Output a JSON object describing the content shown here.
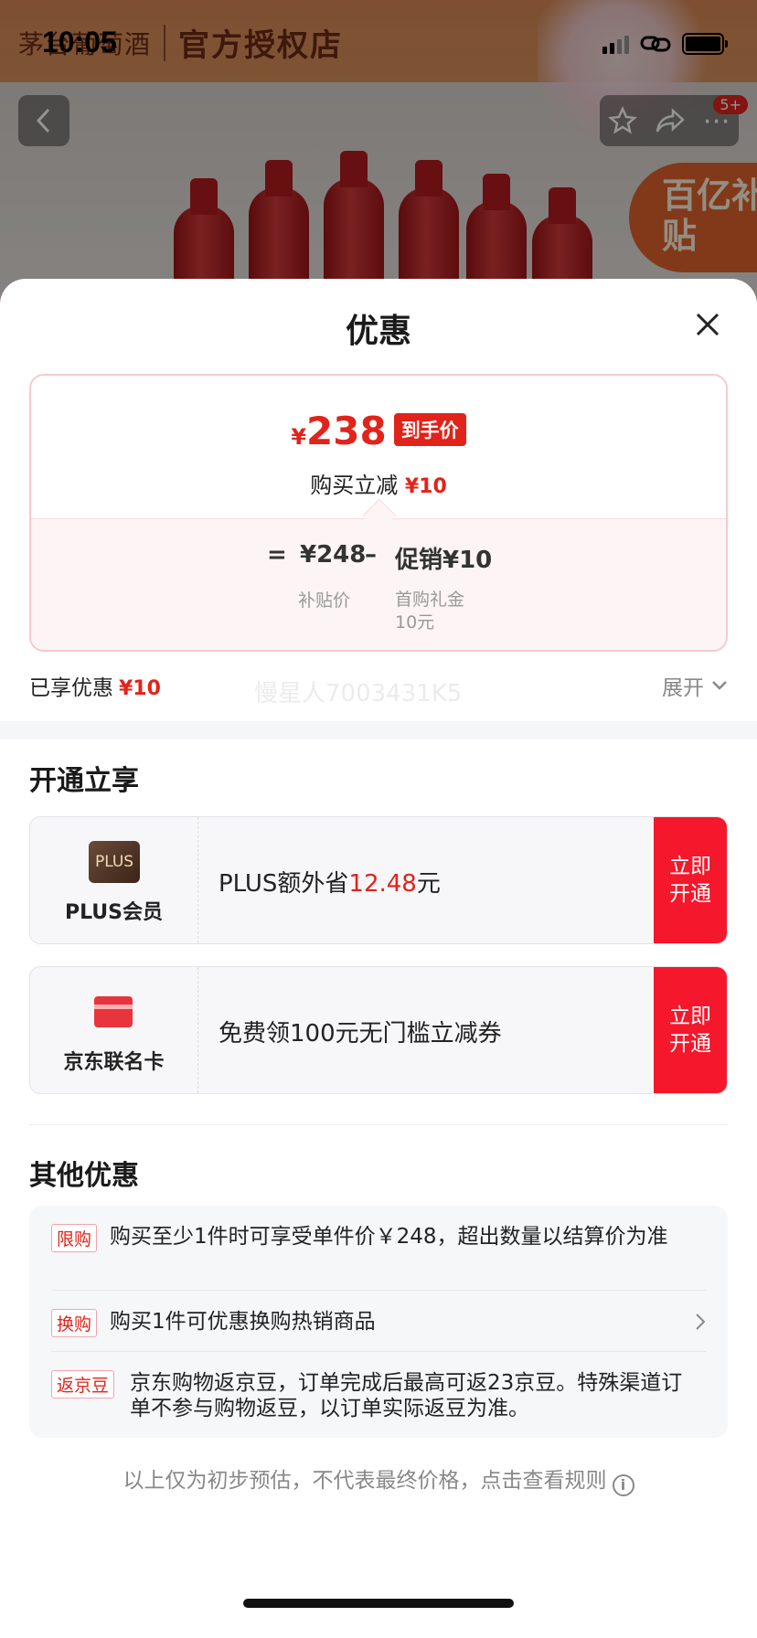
{
  "status_bar": {
    "time": "10:05"
  },
  "background": {
    "shop_logo": "茅台葡萄酒",
    "shop_name": "官方授权店",
    "badge_text": "百亿补贴",
    "notification_count": "5+"
  },
  "sheet": {
    "title": "优惠"
  },
  "price_box": {
    "currency": "¥",
    "final_price": "238",
    "final_tag": "到手价",
    "discount_label": "购买立减",
    "discount_amount": "¥10",
    "formula_equal": "=",
    "base_price": "¥248",
    "formula_minus": "–",
    "promo_label": "促销¥10",
    "base_price_label": "补贴价",
    "promo_detail_1": "首购礼金",
    "promo_detail_2": "10元"
  },
  "saved": {
    "label": "已享优惠",
    "amount": "¥10",
    "expand_label": "展开"
  },
  "open_section": {
    "title": "开通立享",
    "watermark": "慢星人7003431K5"
  },
  "plus_card": {
    "icon_text": "PLUS",
    "name": "PLUS会员",
    "text_prefix": "PLUS额外省",
    "amount": "12.48",
    "text_suffix": "元",
    "button": "立即开通"
  },
  "jd_card": {
    "name": "京东联名卡",
    "text": "免费领100元无门槛立减券",
    "button": "立即开通"
  },
  "others": {
    "title": "其他优惠",
    "items": [
      {
        "tag": "限购",
        "text": "购买至少1件时可享受单件价￥248，超出数量以结算价为准"
      },
      {
        "tag": "换购",
        "text": "购买1件可优惠换购热销商品"
      },
      {
        "tag": "返京豆",
        "text": "京东购物返京豆，订单完成后最高可返23京豆。特殊渠道订单不参与购物返豆，以订单实际返豆为准。"
      }
    ]
  },
  "footer": {
    "note": "以上仅为初步预估，不代表最终价格，点击查看规则",
    "info_icon": "i"
  },
  "colors": {
    "accent": "#e2231a",
    "button_red": "#f5172b"
  }
}
